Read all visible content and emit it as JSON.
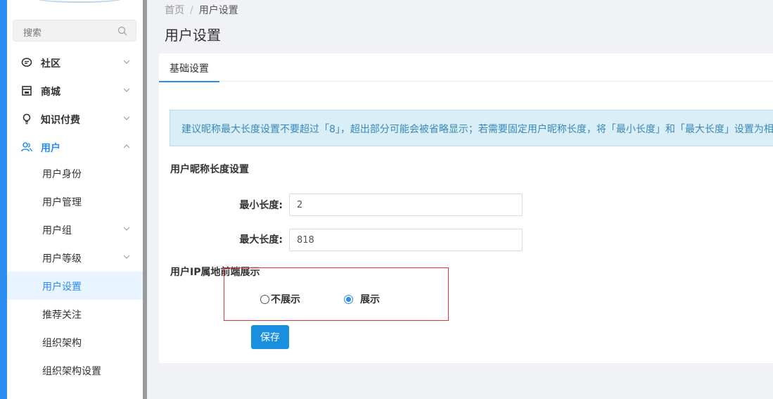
{
  "sidebar": {
    "search_placeholder": "搜索",
    "menu": [
      {
        "label": "社区",
        "icon": "chat-bubble-icon"
      },
      {
        "label": "商城",
        "icon": "store-icon"
      },
      {
        "label": "知识付费",
        "icon": "lightbulb-icon"
      },
      {
        "label": "用户",
        "icon": "users-icon"
      }
    ],
    "submenu": [
      {
        "label": "用户身份"
      },
      {
        "label": "用户管理"
      },
      {
        "label": "用户组"
      },
      {
        "label": "用户等级"
      },
      {
        "label": "用户设置"
      },
      {
        "label": "推荐关注"
      },
      {
        "label": "组织架构"
      },
      {
        "label": "组织架构设置"
      }
    ]
  },
  "breadcrumb": {
    "home": "首页",
    "separator": "/",
    "current": "用户设置"
  },
  "page_title": "用户设置",
  "tabs": [
    {
      "label": "基础设置",
      "active": true
    }
  ],
  "alert": {
    "text": "建议昵称最大长度设置不要超过「8」，超出部分可能会被省略显示；若需要固定用户昵称长度，将「最小长度」和「最大长度」设置为相"
  },
  "nickname_section": {
    "title": "用户昵称长度设置",
    "min_label": "最小长度:",
    "min_value": "2",
    "max_label": "最大长度:",
    "max_value": "818"
  },
  "ip_section": {
    "title": "用户IP属地前端展示",
    "options": [
      {
        "label": "不展示",
        "checked": false
      },
      {
        "label": "展示",
        "checked": true
      }
    ]
  },
  "save_label": "保存",
  "colors": {
    "accent": "#2d8cf0",
    "alert_bg": "#d9eef7",
    "alert_text": "#3b88b8",
    "highlight_border": "#d9383e",
    "save_button": "#1a8fe0"
  }
}
